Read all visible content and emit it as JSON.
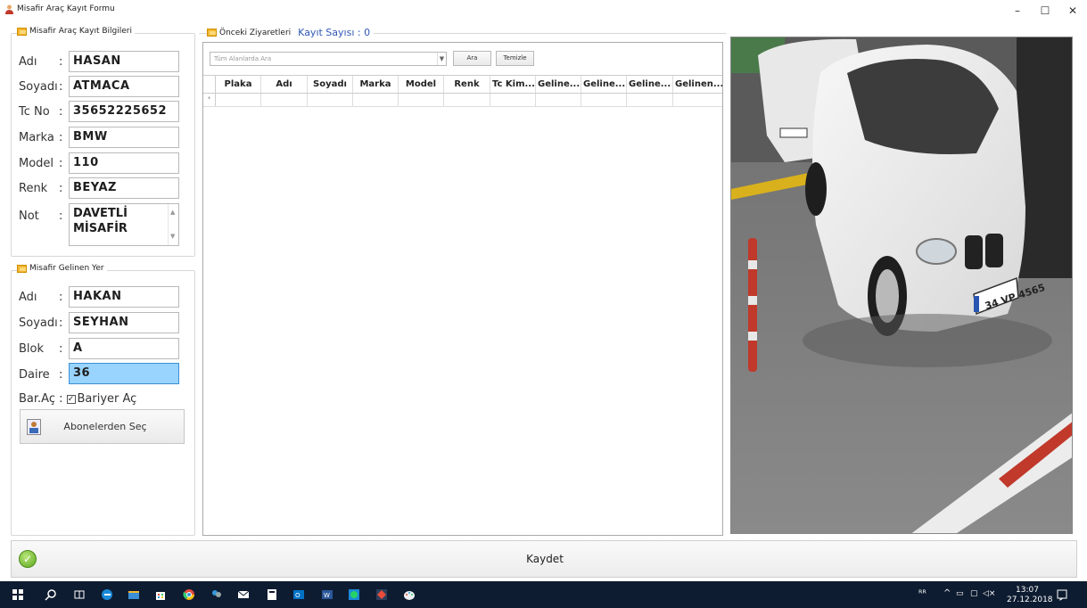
{
  "window": {
    "title": "Misafir Araç Kayıt Formu",
    "controls": {
      "minimize": "–",
      "maximize": "☐",
      "close": "✕"
    }
  },
  "guest_group": {
    "legend": "Misafir Araç Kayıt Bilgileri",
    "fields": [
      {
        "label": "Adı",
        "sep": ":",
        "value": "HASAN"
      },
      {
        "label": "Soyadı",
        "sep": ":",
        "value": "ATMACA"
      },
      {
        "label": "Tc No",
        "sep": ":",
        "value": "35652225652"
      },
      {
        "label": "Marka",
        "sep": ":",
        "value": "BMW"
      },
      {
        "label": "Model",
        "sep": ":",
        "value": "110"
      },
      {
        "label": "Renk",
        "sep": ":",
        "value": "BEYAZ"
      }
    ],
    "note_label": "Not",
    "note_sep": ":",
    "note_value_line1": "DAVETLİ",
    "note_value_line2": "MİSAFİR"
  },
  "host_group": {
    "legend": "Misafir Gelinen Yer",
    "fields": [
      {
        "label": "Adı",
        "sep": ":",
        "value": "HAKAN"
      },
      {
        "label": "Soyadı",
        "sep": ":",
        "value": "SEYHAN"
      },
      {
        "label": "Blok",
        "sep": ":",
        "value": "A"
      },
      {
        "label": "Daire",
        "sep": ":",
        "value": "36"
      }
    ],
    "barrier_label": "Bar.Aç :",
    "barrier_checkbox_label": "Bariyer Aç",
    "barrier_checked": true,
    "subscriber_button": "Abonelerden Seç"
  },
  "previous": {
    "legend": "Önceki Ziyaretleri",
    "count_label": "Kayıt Sayısı : 0",
    "search_placeholder": "Tüm Alanlarda Ara",
    "search_button": "Ara",
    "clear_button": "Temizle",
    "columns": [
      "Plaka",
      "Adı",
      "Soyadı",
      "Marka",
      "Model",
      "Renk",
      "Tc Kim...",
      "Geline...",
      "Geline...",
      "Geline...",
      "Gelinen..."
    ],
    "new_row_marker": "*"
  },
  "camera": {
    "plate_text": "34 VP 4565",
    "accent_color": "#c0392b"
  },
  "save_bar": {
    "label": "Kaydet",
    "icon": "check-circle-icon"
  },
  "taskbar": {
    "time": "13:07",
    "date": "27.12.2018"
  }
}
